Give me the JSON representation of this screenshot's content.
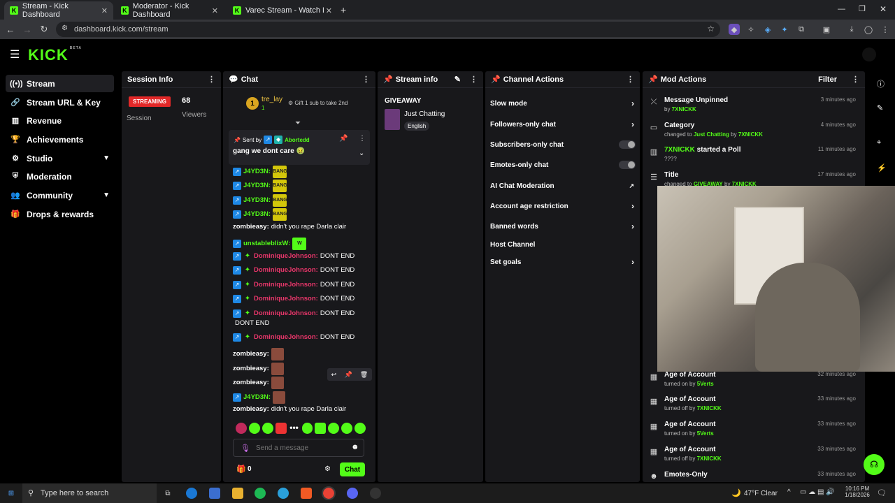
{
  "browser": {
    "tabs": [
      {
        "label": "Stream - Kick Dashboard"
      },
      {
        "label": "Moderator - Kick Dashboard"
      },
      {
        "label": "Varec Stream - Watch Live on K"
      }
    ],
    "url": "dashboard.kick.com/stream"
  },
  "brand": {
    "logo": "KICK",
    "beta": "BETA",
    "accent": "#53fc18"
  },
  "sidebar": {
    "items": [
      {
        "label": "Stream",
        "icon": "broadcast-icon"
      },
      {
        "label": "Stream URL & Key",
        "icon": "link-icon"
      },
      {
        "label": "Revenue",
        "icon": "chart-icon"
      },
      {
        "label": "Achievements",
        "icon": "trophy-icon"
      },
      {
        "label": "Studio",
        "icon": "studio-icon"
      },
      {
        "label": "Moderation",
        "icon": "shield-icon"
      },
      {
        "label": "Community",
        "icon": "people-icon"
      },
      {
        "label": "Drops & rewards",
        "icon": "gift-icon"
      }
    ]
  },
  "session": {
    "title": "Session Info",
    "status": "STREAMING",
    "viewers": "68",
    "session_label": "Session",
    "viewers_label": "Viewers"
  },
  "chat": {
    "title": "Chat",
    "gifter_rank": "1",
    "gifter_name": "tre_lay",
    "gifter_count": "1",
    "gift_prompt": "Gift 1 sub to take 2nd",
    "pinned_sent_by": "Sent by",
    "pinned_author": "Abortedd",
    "pinned_text": "gang we dont care 🤢",
    "messages": [
      {
        "user": "J4YD3N:",
        "text": "BANG",
        "kind": "emote"
      },
      {
        "user": "J4YD3N:",
        "text": "BANG",
        "kind": "emote"
      },
      {
        "user": "J4YD3N:",
        "text": "BANG",
        "kind": "emote"
      },
      {
        "user": "J4YD3N:",
        "text": "BANG",
        "kind": "emote"
      },
      {
        "user": "zombieasy:",
        "text": "didn't you rape Darla clair",
        "kind": "text"
      },
      {
        "user": "unstableblixW:",
        "text": "W",
        "kind": "emote"
      },
      {
        "user": "DominiqueJohnson:",
        "text": "DONT END",
        "kind": "text"
      },
      {
        "user": "DominiqueJohnson:",
        "text": "DONT END",
        "kind": "text"
      },
      {
        "user": "DominiqueJohnson:",
        "text": "DONT END",
        "kind": "text"
      },
      {
        "user": "DominiqueJohnson:",
        "text": "DONT END",
        "kind": "text"
      },
      {
        "user": "DominiqueJohnson:",
        "text": "DONT END",
        "kind": "text"
      },
      {
        "user": "",
        "text": "DONT END",
        "kind": "text"
      },
      {
        "user": "DominiqueJohnson:",
        "text": "DONT END",
        "kind": "text"
      },
      {
        "user": "zombieasy:",
        "text": "",
        "kind": "image"
      },
      {
        "user": "zombieasy:",
        "text": "",
        "kind": "image"
      },
      {
        "user": "zombieasy:",
        "text": "",
        "kind": "image"
      },
      {
        "user": "J4YD3N:",
        "text": "",
        "kind": "image"
      },
      {
        "user": "zombieasy:",
        "text": "didn't you rape Darla clair",
        "kind": "text"
      }
    ],
    "input_placeholder": "Send a message",
    "points": "0",
    "send_label": "Chat"
  },
  "stream_info": {
    "title": "Stream info",
    "stream_title": "GIVEAWAY",
    "category": "Just Chatting",
    "language": "English"
  },
  "channel_actions": {
    "title": "Channel Actions",
    "items": [
      {
        "label": "Slow mode",
        "control": "arrow"
      },
      {
        "label": "Followers-only chat",
        "control": "arrow"
      },
      {
        "label": "Subscribers-only chat",
        "control": "toggle"
      },
      {
        "label": "Emotes-only chat",
        "control": "toggle"
      },
      {
        "label": "AI Chat Moderation",
        "control": "external"
      },
      {
        "label": "Account age restriction",
        "control": "arrow"
      },
      {
        "label": "Banned words",
        "control": "arrow"
      },
      {
        "label": "Host Channel",
        "control": "none"
      },
      {
        "label": "Set goals",
        "control": "arrow"
      }
    ]
  },
  "mod_actions": {
    "title": "Mod Actions",
    "filter_label": "Filter",
    "items": [
      {
        "title": "Message Unpinned",
        "sub": "by 7XNICKK",
        "time": "3 minutes ago",
        "icon": "unpin-icon"
      },
      {
        "title": "Category",
        "sub": "changed to Just Chatting by 7XNICKK",
        "time": "4 minutes ago",
        "icon": "category-icon"
      },
      {
        "title": "7XNICKK started a Poll",
        "sub": "????",
        "time": "11 minutes ago",
        "icon": "poll-icon"
      },
      {
        "title": "Title",
        "sub": "changed to GIVEAWAY by 7XNICKK",
        "time": "17 minutes ago",
        "icon": "title-icon"
      },
      {
        "title": "Age of Account",
        "sub": "turned on by 5Verts",
        "time": "32 minutes ago",
        "icon": "calendar-icon"
      },
      {
        "title": "Age of Account",
        "sub": "turned off by 7XNICKK",
        "time": "33 minutes ago",
        "icon": "calendar-icon"
      },
      {
        "title": "Age of Account",
        "sub": "turned on by 5Verts",
        "time": "33 minutes ago",
        "icon": "calendar-icon"
      },
      {
        "title": "Age of Account",
        "sub": "turned off by 7XNICKK",
        "time": "33 minutes ago",
        "icon": "calendar-icon"
      },
      {
        "title": "Emotes-Only",
        "sub": "",
        "time": "33 minutes ago",
        "icon": "emote-icon"
      }
    ]
  },
  "taskbar": {
    "search_placeholder": "Type here to search",
    "weather": "47°F  Clear",
    "time": "10:16 PM",
    "date": "1/18/2026"
  }
}
